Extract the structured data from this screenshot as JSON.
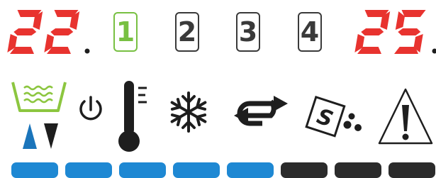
{
  "colors": {
    "segment_on": "#e8332f",
    "program_active": "#78c042",
    "program_idle": "#3a3a3a",
    "icon": "#1e1e1e",
    "bath_icon": "#8cc63f",
    "arrow_up": "#1b75bb",
    "key_blue": "#1e88d3",
    "key_dark": "#2b2b2b"
  },
  "displays": [
    {
      "digits": [
        "2",
        "2"
      ],
      "decimal_point": true
    },
    {
      "digits": [
        "2",
        "5"
      ],
      "decimal_point": true
    }
  ],
  "programs": [
    {
      "label": "1",
      "active": true
    },
    {
      "label": "2",
      "active": false
    },
    {
      "label": "3",
      "active": false
    },
    {
      "label": "4",
      "active": false
    }
  ],
  "icons": {
    "water_bath": "water-bath-icon",
    "arrows": "up-down-arrows-icon",
    "power": "power-icon",
    "thermometer": "thermometer-icon",
    "snowflake": "snowflake-icon",
    "cycle": "cycle-arrows-icon",
    "salt": "salt-icon",
    "warning": "warning-triangle-icon"
  },
  "salt_letter": "S",
  "keys": [
    {
      "color": "key_blue"
    },
    {
      "color": "key_blue"
    },
    {
      "color": "key_blue"
    },
    {
      "color": "key_blue"
    },
    {
      "color": "key_blue"
    },
    {
      "color": "key_dark"
    },
    {
      "color": "key_dark"
    },
    {
      "color": "key_dark"
    }
  ]
}
